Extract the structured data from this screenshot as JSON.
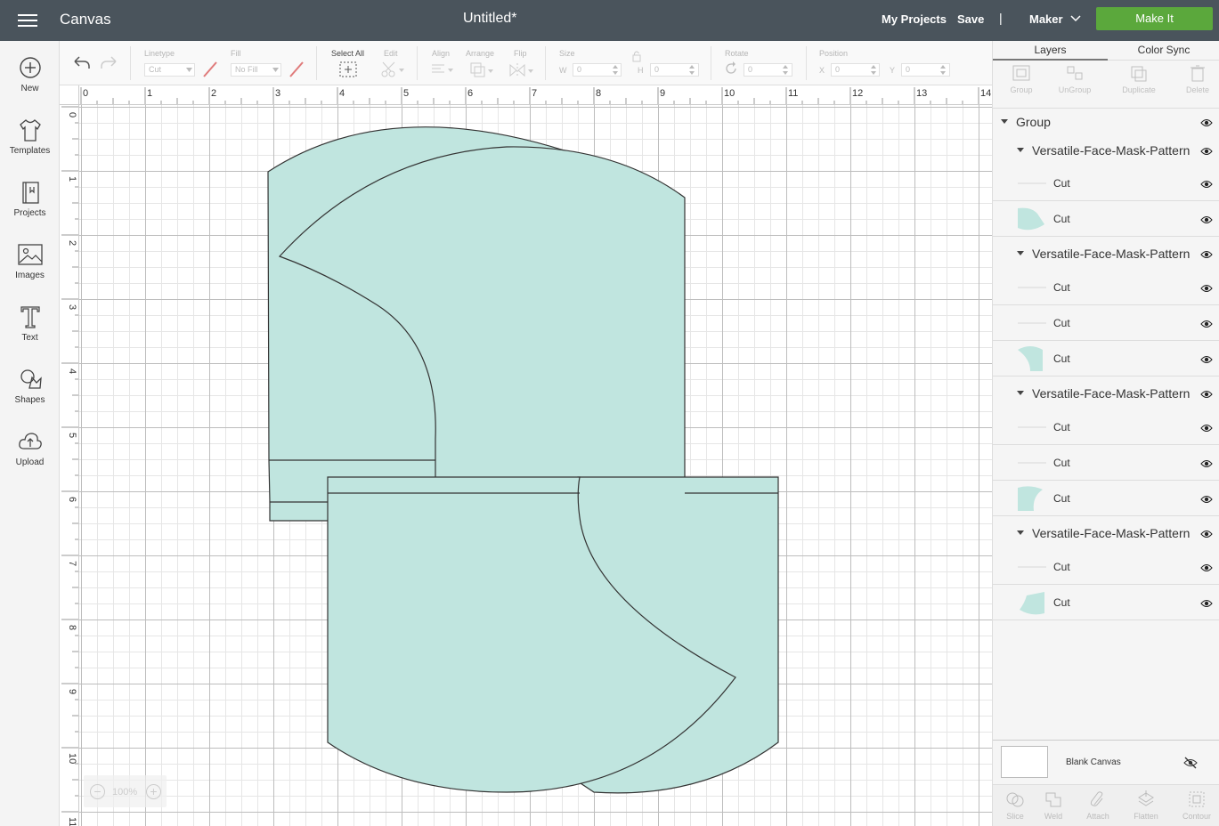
{
  "header": {
    "app_title": "Canvas",
    "doc_title": "Untitled*",
    "my_projects": "My Projects",
    "save": "Save",
    "separator": "|",
    "machine": "Maker",
    "make_it": "Make It",
    "make_it_color": "#5ba83c"
  },
  "sidebar": {
    "items": [
      {
        "label": "New",
        "icon": "plus-circle-icon"
      },
      {
        "label": "Templates",
        "icon": "tshirt-icon"
      },
      {
        "label": "Projects",
        "icon": "projects-icon"
      },
      {
        "label": "Images",
        "icon": "image-icon"
      },
      {
        "label": "Text",
        "icon": "text-icon"
      },
      {
        "label": "Shapes",
        "icon": "shapes-icon"
      },
      {
        "label": "Upload",
        "icon": "cloud-upload-icon"
      }
    ]
  },
  "toolbar": {
    "linetype_label": "Linetype",
    "linetype_value": "Cut",
    "fill_label": "Fill",
    "fill_value": "No Fill",
    "select_all": "Select All",
    "edit": "Edit",
    "align": "Align",
    "arrange": "Arrange",
    "flip": "Flip",
    "size": "Size",
    "w": "W",
    "h": "H",
    "w_value": "0",
    "h_value": "0",
    "rotate": "Rotate",
    "rotate_value": "0",
    "position": "Position",
    "x": "X",
    "y": "Y",
    "x_value": "0",
    "y_value": "0"
  },
  "rulers": {
    "top": [
      "0",
      "1",
      "2",
      "3",
      "4",
      "5",
      "6",
      "7",
      "8",
      "9",
      "10",
      "11",
      "12",
      "13",
      "14"
    ],
    "left": [
      "0",
      "1",
      "2",
      "3",
      "4",
      "5",
      "6",
      "7",
      "8",
      "9",
      "10",
      "11"
    ]
  },
  "canvas": {
    "shape_fill": "#c0e5df",
    "zoom": "100%"
  },
  "layers_panel": {
    "tab_layers": "Layers",
    "tab_color_sync": "Color Sync",
    "actions": [
      "Group",
      "UnGroup",
      "Duplicate",
      "Delete"
    ],
    "group_label": "Group",
    "subgroups": [
      {
        "name": "Versatile-Face-Mask-Pattern",
        "items": [
          "Cut",
          "Cut"
        ]
      },
      {
        "name": "Versatile-Face-Mask-Pattern",
        "items": [
          "Cut",
          "Cut",
          "Cut"
        ]
      },
      {
        "name": "Versatile-Face-Mask-Pattern",
        "items": [
          "Cut",
          "Cut",
          "Cut"
        ]
      },
      {
        "name": "Versatile-Face-Mask-Pattern",
        "items": [
          "Cut",
          "Cut"
        ]
      }
    ],
    "blank_canvas": "Blank Canvas",
    "bottom_actions": [
      "Slice",
      "Weld",
      "Attach",
      "Flatten",
      "Contour"
    ]
  }
}
